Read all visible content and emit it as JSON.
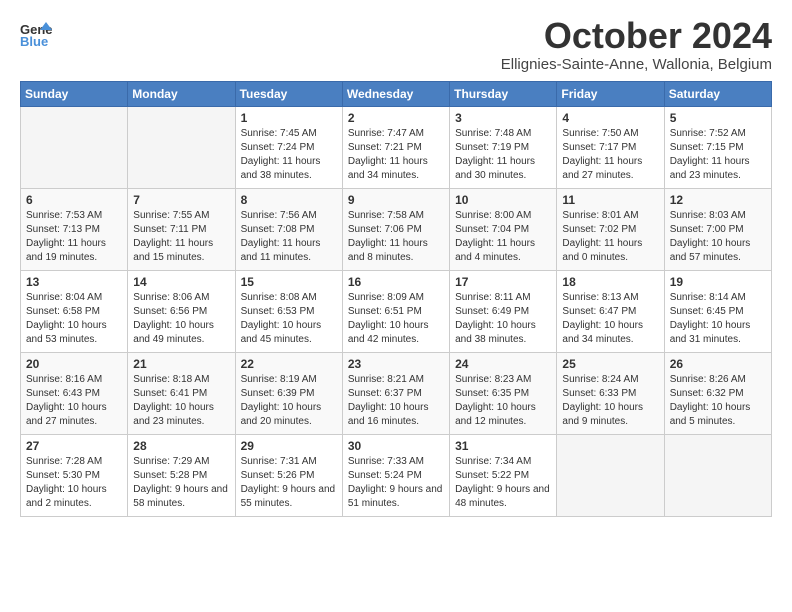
{
  "header": {
    "logo_line1": "General",
    "logo_line2": "Blue",
    "month": "October 2024",
    "location": "Ellignies-Sainte-Anne, Wallonia, Belgium"
  },
  "days_of_week": [
    "Sunday",
    "Monday",
    "Tuesday",
    "Wednesday",
    "Thursday",
    "Friday",
    "Saturday"
  ],
  "weeks": [
    {
      "days": [
        {
          "num": "",
          "empty": true
        },
        {
          "num": "",
          "empty": true
        },
        {
          "num": "1",
          "sunrise": "7:45 AM",
          "sunset": "7:24 PM",
          "daylight": "11 hours and 38 minutes."
        },
        {
          "num": "2",
          "sunrise": "7:47 AM",
          "sunset": "7:21 PM",
          "daylight": "11 hours and 34 minutes."
        },
        {
          "num": "3",
          "sunrise": "7:48 AM",
          "sunset": "7:19 PM",
          "daylight": "11 hours and 30 minutes."
        },
        {
          "num": "4",
          "sunrise": "7:50 AM",
          "sunset": "7:17 PM",
          "daylight": "11 hours and 27 minutes."
        },
        {
          "num": "5",
          "sunrise": "7:52 AM",
          "sunset": "7:15 PM",
          "daylight": "11 hours and 23 minutes."
        }
      ]
    },
    {
      "days": [
        {
          "num": "6",
          "sunrise": "7:53 AM",
          "sunset": "7:13 PM",
          "daylight": "11 hours and 19 minutes."
        },
        {
          "num": "7",
          "sunrise": "7:55 AM",
          "sunset": "7:11 PM",
          "daylight": "11 hours and 15 minutes."
        },
        {
          "num": "8",
          "sunrise": "7:56 AM",
          "sunset": "7:08 PM",
          "daylight": "11 hours and 11 minutes."
        },
        {
          "num": "9",
          "sunrise": "7:58 AM",
          "sunset": "7:06 PM",
          "daylight": "11 hours and 8 minutes."
        },
        {
          "num": "10",
          "sunrise": "8:00 AM",
          "sunset": "7:04 PM",
          "daylight": "11 hours and 4 minutes."
        },
        {
          "num": "11",
          "sunrise": "8:01 AM",
          "sunset": "7:02 PM",
          "daylight": "11 hours and 0 minutes."
        },
        {
          "num": "12",
          "sunrise": "8:03 AM",
          "sunset": "7:00 PM",
          "daylight": "10 hours and 57 minutes."
        }
      ]
    },
    {
      "days": [
        {
          "num": "13",
          "sunrise": "8:04 AM",
          "sunset": "6:58 PM",
          "daylight": "10 hours and 53 minutes."
        },
        {
          "num": "14",
          "sunrise": "8:06 AM",
          "sunset": "6:56 PM",
          "daylight": "10 hours and 49 minutes."
        },
        {
          "num": "15",
          "sunrise": "8:08 AM",
          "sunset": "6:53 PM",
          "daylight": "10 hours and 45 minutes."
        },
        {
          "num": "16",
          "sunrise": "8:09 AM",
          "sunset": "6:51 PM",
          "daylight": "10 hours and 42 minutes."
        },
        {
          "num": "17",
          "sunrise": "8:11 AM",
          "sunset": "6:49 PM",
          "daylight": "10 hours and 38 minutes."
        },
        {
          "num": "18",
          "sunrise": "8:13 AM",
          "sunset": "6:47 PM",
          "daylight": "10 hours and 34 minutes."
        },
        {
          "num": "19",
          "sunrise": "8:14 AM",
          "sunset": "6:45 PM",
          "daylight": "10 hours and 31 minutes."
        }
      ]
    },
    {
      "days": [
        {
          "num": "20",
          "sunrise": "8:16 AM",
          "sunset": "6:43 PM",
          "daylight": "10 hours and 27 minutes."
        },
        {
          "num": "21",
          "sunrise": "8:18 AM",
          "sunset": "6:41 PM",
          "daylight": "10 hours and 23 minutes."
        },
        {
          "num": "22",
          "sunrise": "8:19 AM",
          "sunset": "6:39 PM",
          "daylight": "10 hours and 20 minutes."
        },
        {
          "num": "23",
          "sunrise": "8:21 AM",
          "sunset": "6:37 PM",
          "daylight": "10 hours and 16 minutes."
        },
        {
          "num": "24",
          "sunrise": "8:23 AM",
          "sunset": "6:35 PM",
          "daylight": "10 hours and 12 minutes."
        },
        {
          "num": "25",
          "sunrise": "8:24 AM",
          "sunset": "6:33 PM",
          "daylight": "10 hours and 9 minutes."
        },
        {
          "num": "26",
          "sunrise": "8:26 AM",
          "sunset": "6:32 PM",
          "daylight": "10 hours and 5 minutes."
        }
      ]
    },
    {
      "days": [
        {
          "num": "27",
          "sunrise": "7:28 AM",
          "sunset": "5:30 PM",
          "daylight": "10 hours and 2 minutes."
        },
        {
          "num": "28",
          "sunrise": "7:29 AM",
          "sunset": "5:28 PM",
          "daylight": "9 hours and 58 minutes."
        },
        {
          "num": "29",
          "sunrise": "7:31 AM",
          "sunset": "5:26 PM",
          "daylight": "9 hours and 55 minutes."
        },
        {
          "num": "30",
          "sunrise": "7:33 AM",
          "sunset": "5:24 PM",
          "daylight": "9 hours and 51 minutes."
        },
        {
          "num": "31",
          "sunrise": "7:34 AM",
          "sunset": "5:22 PM",
          "daylight": "9 hours and 48 minutes."
        },
        {
          "num": "",
          "empty": true
        },
        {
          "num": "",
          "empty": true
        }
      ]
    }
  ],
  "labels": {
    "sunrise": "Sunrise:",
    "sunset": "Sunset:",
    "daylight": "Daylight:"
  }
}
